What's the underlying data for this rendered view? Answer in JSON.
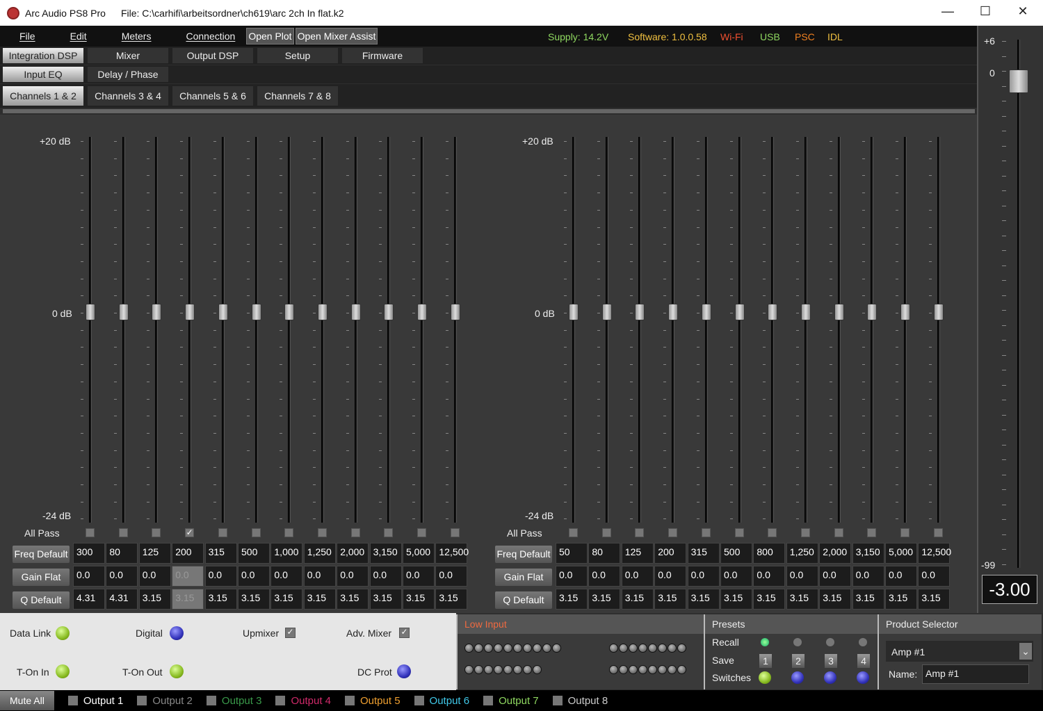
{
  "window": {
    "app": "Arc Audio PS8 Pro",
    "file": "File: C:\\carhifi\\arbeitsordner\\ch619\\arc 2ch In flat.k2",
    "min": "—",
    "max": "☐",
    "close": "✕"
  },
  "menu": {
    "items": [
      "File",
      "Edit",
      "Meters",
      "Connection"
    ],
    "open_plot": "Open Plot",
    "open_mixer_assist": "Open Mixer Assist"
  },
  "status_bar": {
    "supply": "Supply:  14.2V",
    "software": "Software: 1.0.0.58",
    "wifi": "Wi-Fi",
    "usb": "USB",
    "psc": "PSC",
    "idl": "IDL"
  },
  "tabs": {
    "main": [
      "Integration DSP",
      "Mixer",
      "Output DSP",
      "Setup",
      "Firmware"
    ],
    "sub": [
      "Input EQ",
      "Delay / Phase"
    ],
    "channels": [
      "Channels 1 & 2",
      "Channels 3 & 4",
      "Channels 5 & 6",
      "Channels 7 & 8"
    ]
  },
  "eq": {
    "top_label": "+20 dB",
    "mid_label": "0 dB",
    "bottom_label": "-24 dB",
    "all_pass": "All Pass",
    "freq_btn": "Freq Default",
    "gain_btn": "Gain Flat",
    "q_btn": "Q Default",
    "left": {
      "freq": [
        "300",
        "80",
        "125",
        "200",
        "315",
        "500",
        "1,000",
        "1,250",
        "2,000",
        "3,150",
        "5,000",
        "12,500"
      ],
      "gain": [
        "0.0",
        "0.0",
        "0.0",
        "0.0",
        "0.0",
        "0.0",
        "0.0",
        "0.0",
        "0.0",
        "0.0",
        "0.0",
        "0.0"
      ],
      "q": [
        "4.31",
        "4.31",
        "3.15",
        "3.15",
        "3.15",
        "3.15",
        "3.15",
        "3.15",
        "3.15",
        "3.15",
        "3.15",
        "3.15"
      ],
      "allpass": [
        false,
        false,
        false,
        true,
        false,
        false,
        false,
        false,
        false,
        false,
        false,
        false
      ],
      "disabled_band": 4
    },
    "right": {
      "freq": [
        "50",
        "80",
        "125",
        "200",
        "315",
        "500",
        "800",
        "1,250",
        "2,000",
        "3,150",
        "5,000",
        "12,500"
      ],
      "gain": [
        "0.0",
        "0.0",
        "0.0",
        "0.0",
        "0.0",
        "0.0",
        "0.0",
        "0.0",
        "0.0",
        "0.0",
        "0.0",
        "0.0"
      ],
      "q": [
        "3.15",
        "3.15",
        "3.15",
        "3.15",
        "3.15",
        "3.15",
        "3.15",
        "3.15",
        "3.15",
        "3.15",
        "3.15",
        "3.15"
      ],
      "allpass": [
        false,
        false,
        false,
        false,
        false,
        false,
        false,
        false,
        false,
        false,
        false,
        false
      ]
    }
  },
  "master": {
    "top": "+6",
    "zero": "0",
    "bottom": "-99",
    "value": "-3.00",
    "level_db": -3.0
  },
  "indicators": {
    "data_link": "Data Link",
    "digital": "Digital",
    "upmixer": "Upmixer",
    "adv_mixer": "Adv. Mixer",
    "t_on_in": "T-On In",
    "t_on_out": "T-On Out",
    "dc_prot": "DC Prot"
  },
  "low_input": {
    "title": "Low Input"
  },
  "presets": {
    "title": "Presets",
    "recall": "Recall",
    "save": "Save",
    "switches": "Switches",
    "nums": [
      "1",
      "2",
      "3",
      "4"
    ]
  },
  "product": {
    "title": "Product Selector",
    "selected": "Amp #1",
    "name_label": "Name:",
    "name": "Amp #1"
  },
  "bottom": {
    "mute_all": "Mute All",
    "outputs": [
      "Output 1",
      "Output 2",
      "Output 3",
      "Output 4",
      "Output 5",
      "Output 6",
      "Output 7",
      "Output 8"
    ],
    "colors": [
      "#ffffff",
      "#888888",
      "#3a9a4a",
      "#d02a6a",
      "#f0a030",
      "#40c8e8",
      "#8fd860",
      "#cccccc"
    ]
  },
  "colors": {
    "supply": "#8fd860",
    "software": "#f0c040",
    "wifi": "#f05030",
    "usb": "#8fd860",
    "psc": "#f08020",
    "idl": "#f0c040"
  }
}
